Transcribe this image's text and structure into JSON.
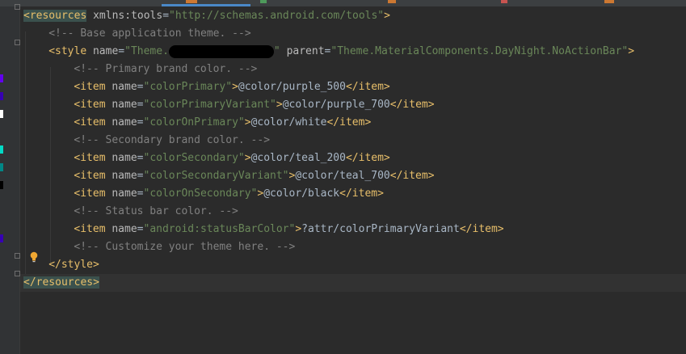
{
  "editor": {
    "lines": [
      {
        "tokens": [
          {
            "t": "tag",
            "v": "<resources"
          },
          {
            "t": "attr",
            "v": " xmlns:tools"
          },
          {
            "t": "text",
            "v": "="
          },
          {
            "t": "val",
            "v": "\"http://schemas.android.com/tools\""
          },
          {
            "t": "tag",
            "v": ">"
          }
        ]
      },
      {
        "tokens": [
          {
            "t": "comment",
            "v": "<!-- Base application theme. -->"
          }
        ]
      },
      {
        "tokens": [
          {
            "t": "tag",
            "v": "<style"
          },
          {
            "t": "attr",
            "v": " name"
          },
          {
            "t": "text",
            "v": "="
          },
          {
            "t": "val",
            "v": "\"Theme."
          },
          {
            "t": "redact",
            "v": ""
          },
          {
            "t": "val",
            "v": "\""
          },
          {
            "t": "attr",
            "v": " parent"
          },
          {
            "t": "text",
            "v": "="
          },
          {
            "t": "val",
            "v": "\"Theme.MaterialComponents.DayNight.NoActionBar\""
          },
          {
            "t": "tag",
            "v": ">"
          }
        ]
      },
      {
        "tokens": [
          {
            "t": "comment",
            "v": "<!-- Primary brand color. -->"
          }
        ]
      },
      {
        "tokens": [
          {
            "t": "tag",
            "v": "<item"
          },
          {
            "t": "attr",
            "v": " name"
          },
          {
            "t": "text",
            "v": "="
          },
          {
            "t": "val",
            "v": "\"colorPrimary\""
          },
          {
            "t": "tag",
            "v": ">"
          },
          {
            "t": "text",
            "v": "@color/purple_500"
          },
          {
            "t": "tag",
            "v": "</item>"
          }
        ]
      },
      {
        "tokens": [
          {
            "t": "tag",
            "v": "<item"
          },
          {
            "t": "attr",
            "v": " name"
          },
          {
            "t": "text",
            "v": "="
          },
          {
            "t": "val",
            "v": "\"colorPrimaryVariant\""
          },
          {
            "t": "tag",
            "v": ">"
          },
          {
            "t": "text",
            "v": "@color/purple_700"
          },
          {
            "t": "tag",
            "v": "</item>"
          }
        ]
      },
      {
        "tokens": [
          {
            "t": "tag",
            "v": "<item"
          },
          {
            "t": "attr",
            "v": " name"
          },
          {
            "t": "text",
            "v": "="
          },
          {
            "t": "val",
            "v": "\"colorOnPrimary\""
          },
          {
            "t": "tag",
            "v": ">"
          },
          {
            "t": "text",
            "v": "@color/white"
          },
          {
            "t": "tag",
            "v": "</item>"
          }
        ]
      },
      {
        "tokens": [
          {
            "t": "comment",
            "v": "<!-- Secondary brand color. -->"
          }
        ]
      },
      {
        "tokens": [
          {
            "t": "tag",
            "v": "<item"
          },
          {
            "t": "attr",
            "v": " name"
          },
          {
            "t": "text",
            "v": "="
          },
          {
            "t": "val",
            "v": "\"colorSecondary\""
          },
          {
            "t": "tag",
            "v": ">"
          },
          {
            "t": "text",
            "v": "@color/teal_200"
          },
          {
            "t": "tag",
            "v": "</item>"
          }
        ]
      },
      {
        "tokens": [
          {
            "t": "tag",
            "v": "<item"
          },
          {
            "t": "attr",
            "v": " name"
          },
          {
            "t": "text",
            "v": "="
          },
          {
            "t": "val",
            "v": "\"colorSecondaryVariant\""
          },
          {
            "t": "tag",
            "v": ">"
          },
          {
            "t": "text",
            "v": "@color/teal_700"
          },
          {
            "t": "tag",
            "v": "</item>"
          }
        ]
      },
      {
        "tokens": [
          {
            "t": "tag",
            "v": "<item"
          },
          {
            "t": "attr",
            "v": " name"
          },
          {
            "t": "text",
            "v": "="
          },
          {
            "t": "val",
            "v": "\"colorOnSecondary\""
          },
          {
            "t": "tag",
            "v": ">"
          },
          {
            "t": "text",
            "v": "@color/black"
          },
          {
            "t": "tag",
            "v": "</item>"
          }
        ]
      },
      {
        "tokens": [
          {
            "t": "comment",
            "v": "<!-- Status bar color. -->"
          }
        ]
      },
      {
        "tokens": [
          {
            "t": "tag",
            "v": "<item"
          },
          {
            "t": "attr",
            "v": " name"
          },
          {
            "t": "text",
            "v": "="
          },
          {
            "t": "val",
            "v": "\"android:statusBarColor\""
          },
          {
            "t": "tag",
            "v": ">"
          },
          {
            "t": "text",
            "v": "?attr/colorPrimaryVariant"
          },
          {
            "t": "tag",
            "v": "</item>"
          }
        ]
      },
      {
        "tokens": [
          {
            "t": "comment",
            "v": "<!-- Customize your theme here. -->"
          }
        ]
      },
      {
        "tokens": [
          {
            "t": "tag",
            "v": "</style>"
          }
        ]
      },
      {
        "tokens": [
          {
            "t": "tag",
            "v": "</resources>"
          }
        ]
      }
    ]
  },
  "gutter": {
    "color_swatches": [
      {
        "line": 5,
        "color": "#6200ee"
      },
      {
        "line": 6,
        "color": "#3700b3"
      },
      {
        "line": 7,
        "color": "#ffffff"
      },
      {
        "line": 9,
        "color": "#03dac5"
      },
      {
        "line": 10,
        "color": "#018786"
      },
      {
        "line": 11,
        "color": "#000000"
      },
      {
        "line": 14,
        "color": "#3700b3"
      }
    ],
    "bulb_icon": "lightbulb-icon"
  },
  "colors": {
    "background": "#2b2b2b",
    "gutter": "#313335",
    "tag": "#e8bf6a",
    "attribute": "#bababa",
    "string": "#6a8759",
    "comment": "#808080",
    "text": "#a9b7c6",
    "current_line": "#323232",
    "brace_match": "#3b514d",
    "bulb": "#f0a732"
  }
}
